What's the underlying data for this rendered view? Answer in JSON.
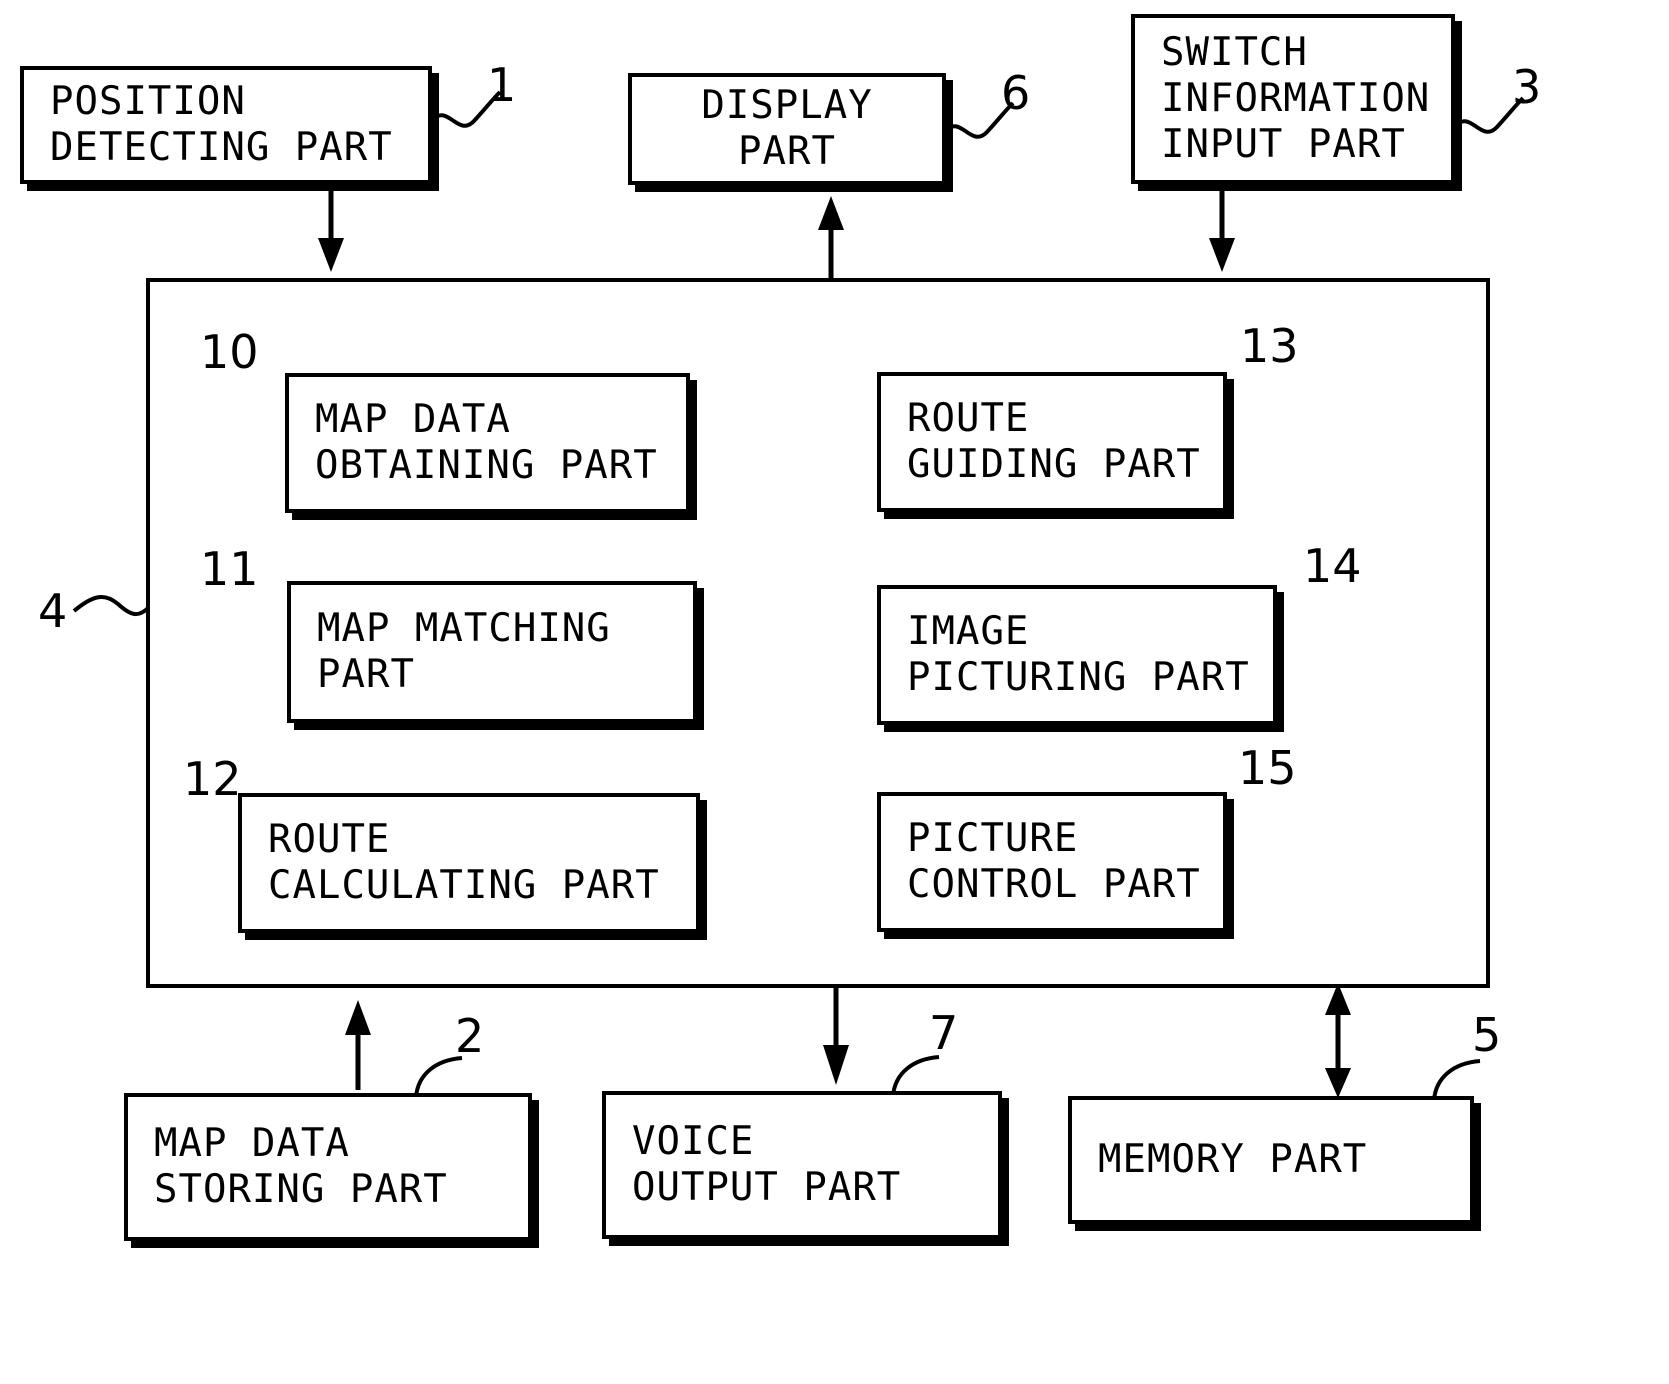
{
  "figure": {
    "type": "patent-block-diagram",
    "title": "Navigation apparatus block diagram"
  },
  "blocks": [
    {
      "id": "position-detecting-part",
      "lines": [
        "POSITION",
        "DETECTING PART"
      ],
      "ref": "1",
      "align": "left"
    },
    {
      "id": "display-part",
      "lines": [
        "DISPLAY",
        "PART"
      ],
      "ref": "6",
      "align": "center"
    },
    {
      "id": "switch-information-input-part",
      "lines": [
        "SWITCH",
        "INFORMATION",
        "INPUT PART"
      ],
      "ref": "3",
      "align": "left"
    },
    {
      "id": "map-data-obtaining-part",
      "lines": [
        "MAP DATA",
        "OBTAINING PART"
      ],
      "ref": "10",
      "align": "left"
    },
    {
      "id": "route-guiding-part",
      "lines": [
        "ROUTE",
        "GUIDING PART"
      ],
      "ref": "13",
      "align": "left"
    },
    {
      "id": "map-matching-part",
      "lines": [
        "MAP MATCHING",
        "PART"
      ],
      "ref": "11",
      "align": "left"
    },
    {
      "id": "image-picturing-part",
      "lines": [
        "IMAGE",
        "PICTURING PART"
      ],
      "ref": "14",
      "align": "left"
    },
    {
      "id": "route-calculating-part",
      "lines": [
        "ROUTE",
        "CALCULATING PART"
      ],
      "ref": "12",
      "align": "left"
    },
    {
      "id": "picture-control-part",
      "lines": [
        "PICTURE",
        "CONTROL PART"
      ],
      "ref": "15",
      "align": "left"
    },
    {
      "id": "map-data-storing-part",
      "lines": [
        "MAP DATA",
        "STORING PART"
      ],
      "ref": "2",
      "align": "left"
    },
    {
      "id": "voice-output-part",
      "lines": [
        "VOICE",
        "OUTPUT PART"
      ],
      "ref": "7",
      "align": "left"
    },
    {
      "id": "memory-part",
      "lines": [
        "MEMORY PART"
      ],
      "ref": "5",
      "align": "left"
    }
  ],
  "container": {
    "id": "navigation-control-unit",
    "ref": "4"
  },
  "labels": {
    "position_detecting_part_l1": "POSITION",
    "position_detecting_part_l2": "DETECTING PART",
    "display_part_l1": "DISPLAY",
    "display_part_l2": "PART",
    "switch_info_l1": "SWITCH",
    "switch_info_l2": "INFORMATION",
    "switch_info_l3": "INPUT PART",
    "map_data_obtaining_l1": "MAP DATA",
    "map_data_obtaining_l2": "OBTAINING PART",
    "route_guiding_l1": "ROUTE",
    "route_guiding_l2": "GUIDING PART",
    "map_matching_l1": "MAP MATCHING",
    "map_matching_l2": "PART",
    "image_picturing_l1": "IMAGE",
    "image_picturing_l2": "PICTURING PART",
    "route_calculating_l1": "ROUTE",
    "route_calculating_l2": "CALCULATING PART",
    "picture_control_l1": "PICTURE",
    "picture_control_l2": "CONTROL PART",
    "map_data_storing_l1": "MAP DATA",
    "map_data_storing_l2": "STORING PART",
    "voice_output_l1": "VOICE",
    "voice_output_l2": "OUTPUT PART",
    "memory_part_l1": "MEMORY PART"
  },
  "refs": {
    "r1": "1",
    "r2": "2",
    "r3": "3",
    "r4": "4",
    "r5": "5",
    "r6": "6",
    "r7": "7",
    "r10": "10",
    "r11": "11",
    "r12": "12",
    "r13": "13",
    "r14": "14",
    "r15": "15"
  },
  "colors": {
    "ink": "#000000",
    "paper": "#ffffff"
  }
}
